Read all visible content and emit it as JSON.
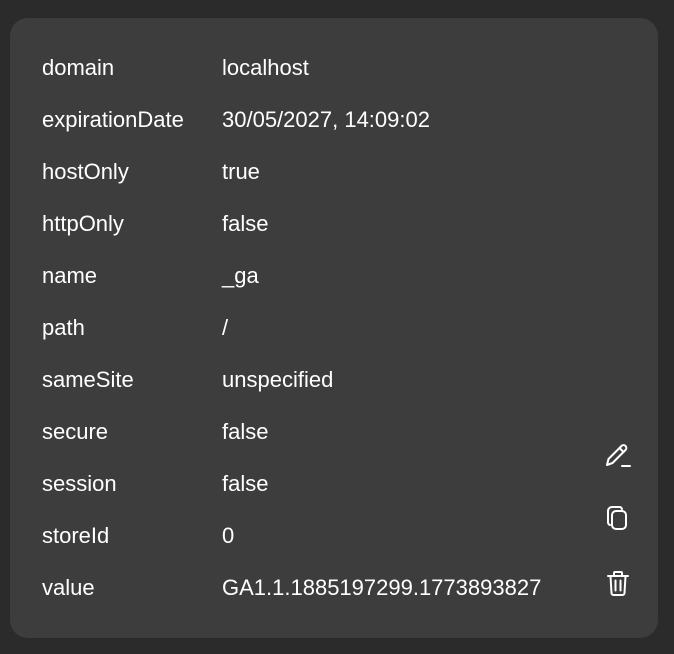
{
  "cookie": {
    "rows": [
      {
        "key": "domain",
        "value": "localhost"
      },
      {
        "key": "expirationDate",
        "value": "30/05/2027, 14:09:02"
      },
      {
        "key": "hostOnly",
        "value": "true"
      },
      {
        "key": "httpOnly",
        "value": "false"
      },
      {
        "key": "name",
        "value": "_ga"
      },
      {
        "key": "path",
        "value": "/"
      },
      {
        "key": "sameSite",
        "value": "unspecified"
      },
      {
        "key": "secure",
        "value": "false"
      },
      {
        "key": "session",
        "value": "false"
      },
      {
        "key": "storeId",
        "value": "0"
      },
      {
        "key": "value",
        "value": "GA1.1.1885197299.1773893827"
      }
    ]
  },
  "actions": {
    "edit_icon": "pencil-icon",
    "copy_icon": "copy-icon",
    "delete_icon": "trash-icon"
  },
  "colors": {
    "page_background": "#2b2b2b",
    "card_background": "#3d3d3d",
    "text": "#ffffff"
  }
}
